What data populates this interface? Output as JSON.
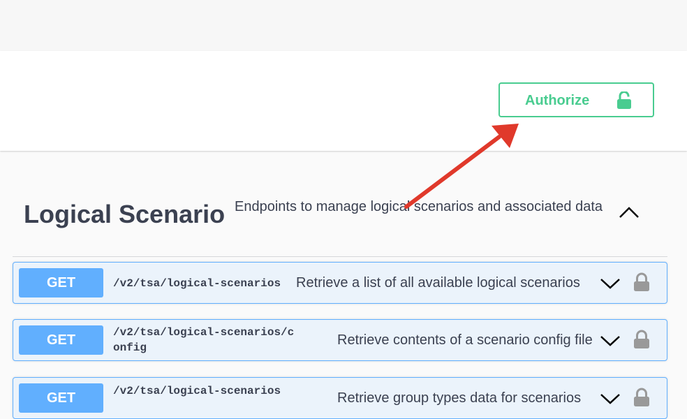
{
  "header": {
    "authorize_label": "Authorize",
    "authorize_icon": "unlock-icon",
    "accent_color": "#49cc90"
  },
  "section": {
    "title": "Logical Scenario",
    "description": "Endpoints to manage logical scenarios and associated data",
    "toggle_icon": "chevron-up-icon"
  },
  "operations": [
    {
      "method": "GET",
      "path": "/v2/tsa/logical-scenarios",
      "summary": "Retrieve a list of all available logical scenarios"
    },
    {
      "method": "GET",
      "path": "/v2/tsa/logical-scenarios/config",
      "summary": "Retrieve contents of a scenario config file"
    },
    {
      "method": "GET",
      "path": "/v2/tsa/logical-scenarios",
      "summary": "Retrieve group types data for scenarios"
    }
  ],
  "colors": {
    "get_method": "#61affe",
    "get_background": "#ebf3fb",
    "annotation_arrow": "#e0392b",
    "text": "#3b4151"
  }
}
